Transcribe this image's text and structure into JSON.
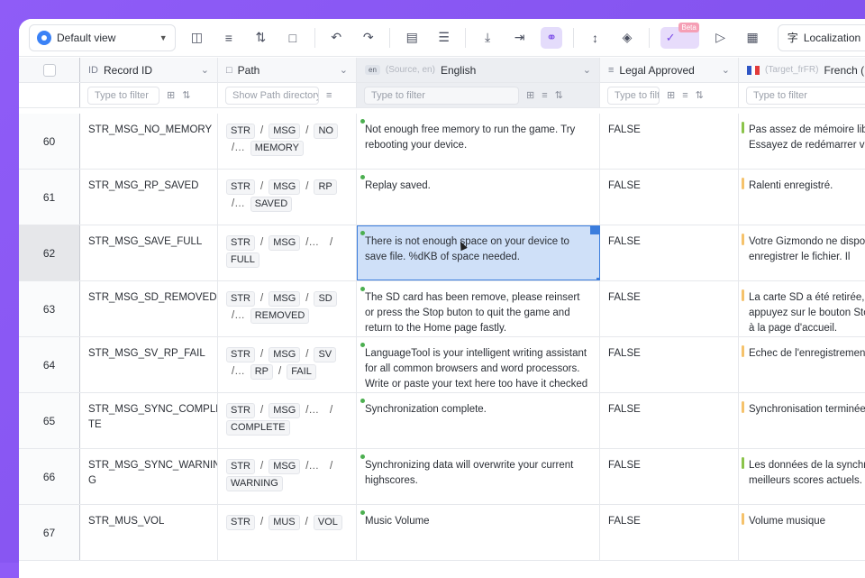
{
  "toolbar": {
    "view_label": "Default view",
    "ai_beta_badge": "Beta",
    "localization_label": "Localization",
    "icons": [
      "columns-icon",
      "filter-icon",
      "sort-icon",
      "folder-icon",
      "undo-icon",
      "redo-icon",
      "group-icon",
      "row-height-icon",
      "download-icon",
      "import-icon",
      "link-icon",
      "fit-icon",
      "fill-icon",
      "ai-icon",
      "tag-icon",
      "layout-icon",
      "translate-icon"
    ]
  },
  "columns": {
    "id": {
      "icon": "ID",
      "label": "Record ID",
      "filter": "Type to filter"
    },
    "path": {
      "label": "Path",
      "filter": "Show Path directory"
    },
    "english": {
      "badge": "en",
      "meta": "(Source, en)",
      "label": "English",
      "filter": "Type to filter"
    },
    "legal": {
      "label": "Legal Approved",
      "filter": "Type to filt"
    },
    "french": {
      "meta": "(Target_frFR)",
      "label": "French (F",
      "filter": "Type to filter"
    }
  },
  "rows": [
    {
      "num": "60",
      "id": "STR_MSG_NO_MEMORY",
      "path": [
        "STR",
        "MSG",
        "NO",
        "/…",
        "MEMORY"
      ],
      "en": "Not enough free memory to run the game. Try rebooting your device.",
      "legal": "FALSE",
      "fr": "Pas assez de mémoire libre. Essayez de redémarrer votr",
      "fr_color": "#8bc34a"
    },
    {
      "num": "61",
      "id": "STR_MSG_RP_SAVED",
      "path": [
        "STR",
        "MSG",
        "RP",
        "/…",
        "SAVED"
      ],
      "en": "Replay saved.",
      "legal": "FALSE",
      "fr": "Ralenti enregistré.",
      "fr_color": "#f5c26b"
    },
    {
      "num": "62",
      "id": "STR_MSG_SAVE_FULL",
      "path": [
        "STR",
        "MSG",
        "/…",
        "/",
        "FULL"
      ],
      "en": "There is not enough space on your device to save file. %dKB of space needed.",
      "legal": "FALSE",
      "fr": "Votre Gizmondo ne dispose pour enregistrer le fichier. Il",
      "fr_color": "#f5c26b"
    },
    {
      "num": "63",
      "id": "STR_MSG_SD_REMOVED",
      "path": [
        "STR",
        "MSG",
        "SD",
        "/…",
        "REMOVED"
      ],
      "en": "The SD card has been remove, please reinsert or press the Stop buton to quit the game and return to the Home page fastly.",
      "legal": "FALSE",
      "fr": "La carte SD a été retirée, ve appuyez sur le bouton Stop revenir à la page d'accueil.",
      "fr_color": "#f5c26b"
    },
    {
      "num": "64",
      "id": "STR_MSG_SV_RP_FAIL",
      "path": [
        "STR",
        "MSG",
        "SV",
        "/…",
        "RP",
        "/",
        "FAIL"
      ],
      "en": "LanguageTool is your intelligent writing assistant for all common browsers and word processors. Write or paste your text here too have it checked …",
      "legal": "FALSE",
      "fr": "Echec de l'enregistrement d",
      "fr_color": "#f5c26b"
    },
    {
      "num": "65",
      "id": "STR_MSG_SYNC_COMPLE TE",
      "path": [
        "STR",
        "MSG",
        "/…",
        "/",
        "COMPLETE"
      ],
      "en": "Synchronization complete.",
      "legal": "FALSE",
      "fr": "Synchronisation terminée.",
      "fr_color": "#f5c26b"
    },
    {
      "num": "66",
      "id": "STR_MSG_SYNC_WARNIN G",
      "path": [
        "STR",
        "MSG",
        "/…",
        "/",
        "WARNING"
      ],
      "en": "Synchronizing data will overwrite your current highscores.",
      "legal": "FALSE",
      "fr": "Les données de la synchron meilleurs scores actuels.",
      "fr_color": "#8bc34a"
    },
    {
      "num": "67",
      "id": "STR_MUS_VOL",
      "path": [
        "STR",
        "MUS",
        "VOL"
      ],
      "en": "Music Volume",
      "legal": "FALSE",
      "fr": "Volume musique",
      "fr_color": "#f5c26b"
    }
  ]
}
